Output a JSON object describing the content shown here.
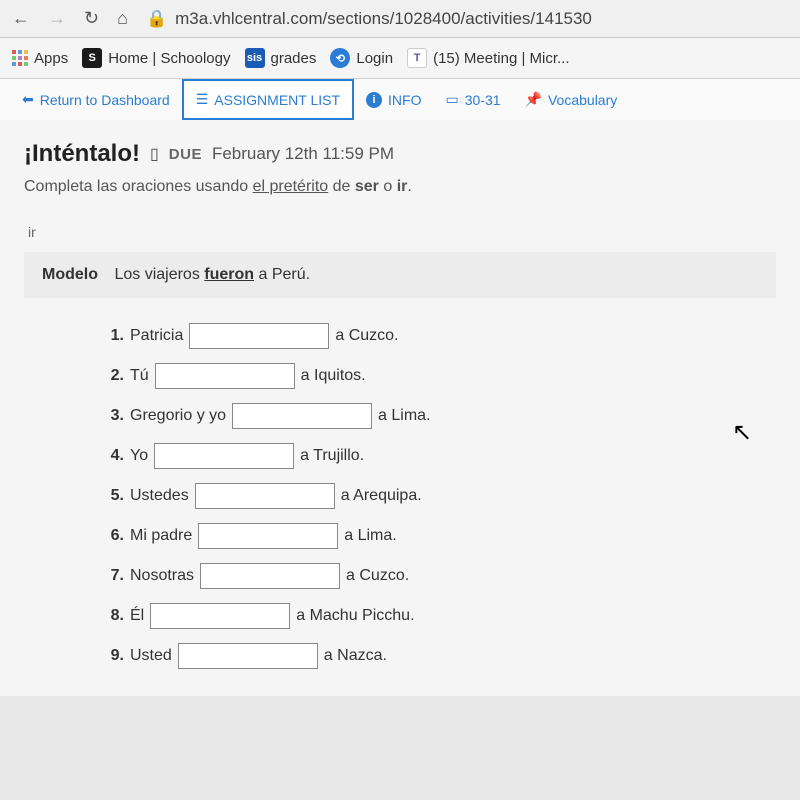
{
  "browser": {
    "url": "m3a.vhlcentral.com/sections/1028400/activities/141530"
  },
  "bookmarks": {
    "apps": "Apps",
    "home": "Home | Schoology",
    "grades": "grades",
    "login": "Login",
    "meeting": "(15) Meeting | Micr..."
  },
  "tabs": {
    "return": "Return to Dashboard",
    "assignment_list": "ASSIGNMENT LIST",
    "info": "INFO",
    "pages": "30-31",
    "vocabulary": "Vocabulary"
  },
  "activity": {
    "title": "¡Inténtalo!",
    "due_label": "DUE",
    "due_date": "February 12th 11:59 PM",
    "instructions_pre": "Completa las oraciones usando ",
    "instructions_underline": "el pretérito",
    "instructions_mid": " de ",
    "instructions_bold1": "ser",
    "instructions_mid2": " o ",
    "instructions_bold2": "ir",
    "instructions_end": ".",
    "section_label": "ir",
    "modelo_label": "Modelo",
    "modelo_pre": "Los viajeros ",
    "modelo_answer": "fueron",
    "modelo_post": " a Perú."
  },
  "questions": [
    {
      "num": "1.",
      "pre": "Patricia",
      "post": "a Cuzco."
    },
    {
      "num": "2.",
      "pre": "Tú",
      "post": "a Iquitos."
    },
    {
      "num": "3.",
      "pre": "Gregorio y yo",
      "post": "a Lima."
    },
    {
      "num": "4.",
      "pre": "Yo",
      "post": "a Trujillo."
    },
    {
      "num": "5.",
      "pre": "Ustedes",
      "post": "a Arequipa."
    },
    {
      "num": "6.",
      "pre": "Mi padre",
      "post": "a Lima."
    },
    {
      "num": "7.",
      "pre": "Nosotras",
      "post": "a Cuzco."
    },
    {
      "num": "8.",
      "pre": "Él",
      "post": "a Machu Picchu."
    },
    {
      "num": "9.",
      "pre": "Usted",
      "post": "a Nazca."
    }
  ]
}
